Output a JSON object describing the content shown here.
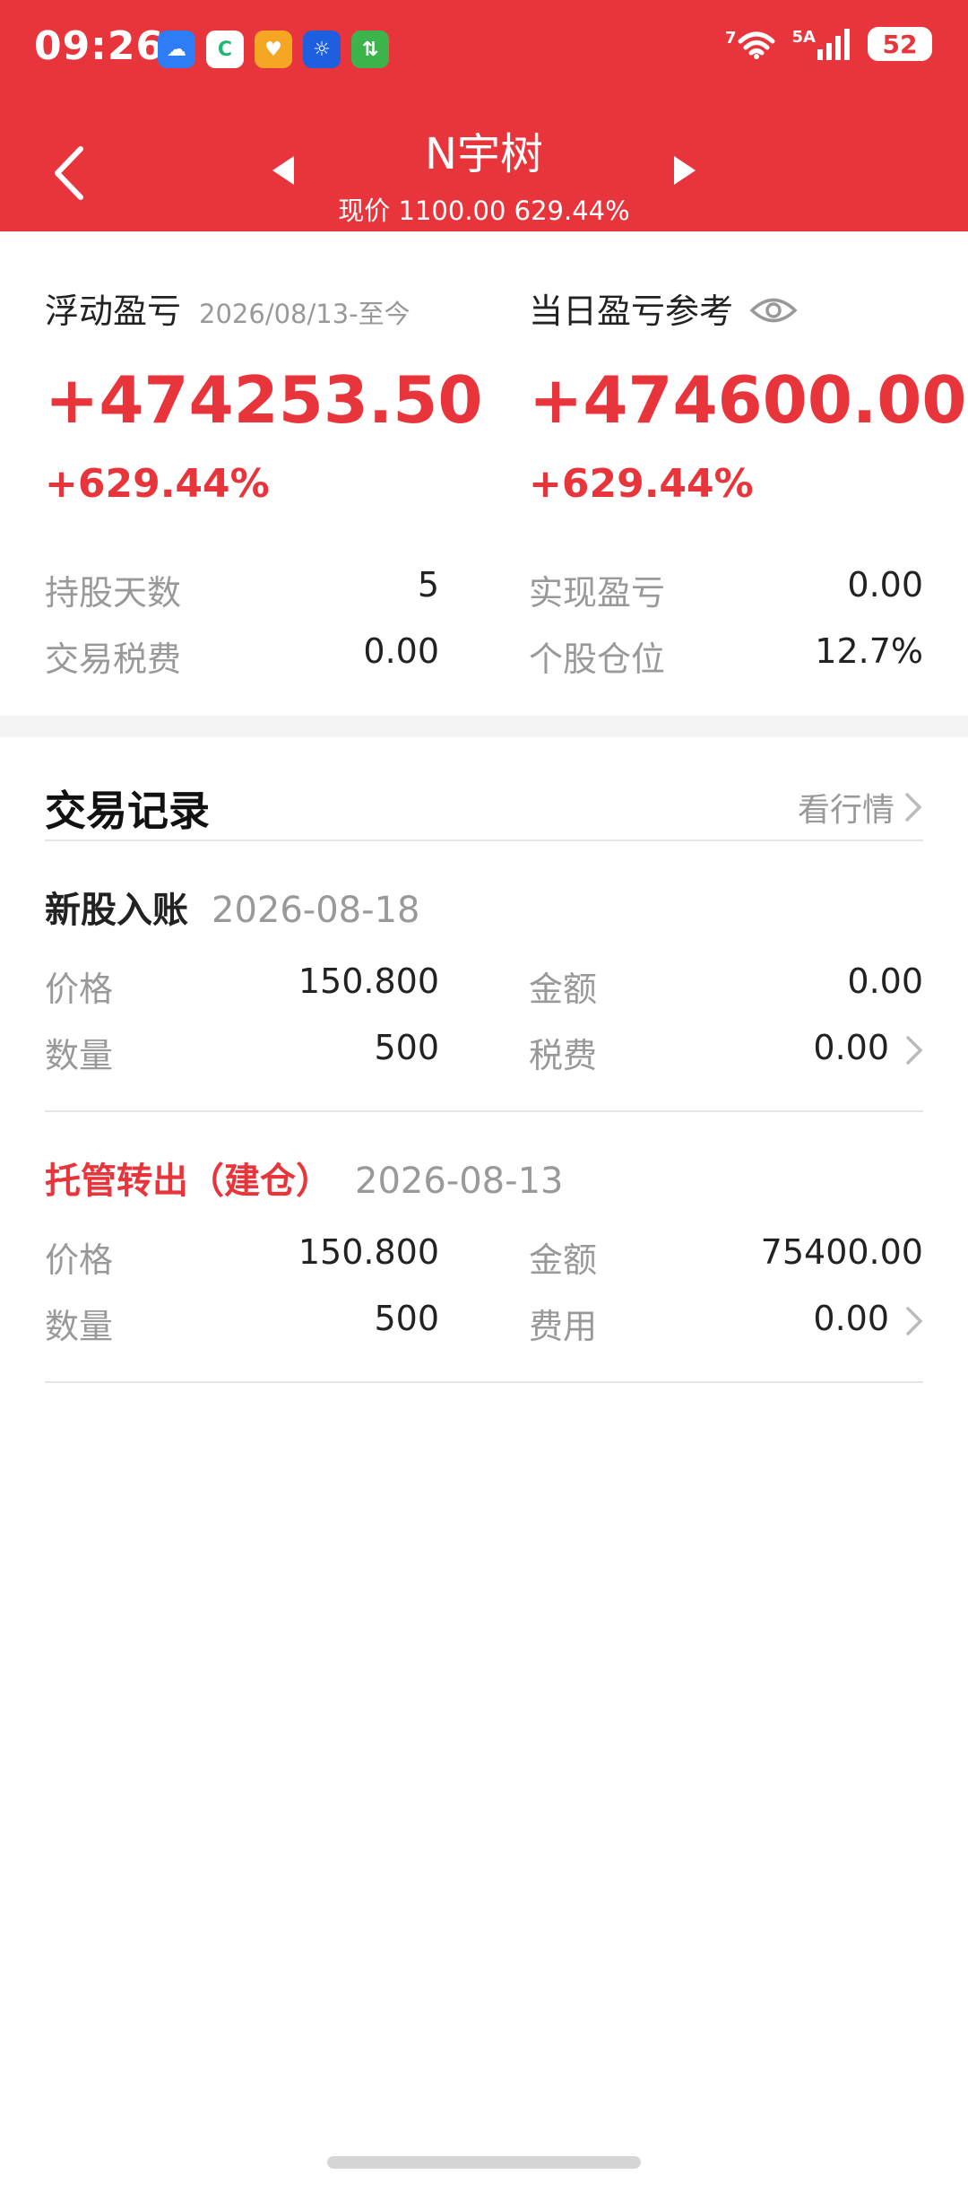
{
  "status_bar": {
    "time": "09:26",
    "apps": [
      {
        "name": "weather-icon",
        "glyph": "☁",
        "color": "#2f7df6"
      },
      {
        "name": "refresh-app-icon",
        "glyph": "C",
        "color": "#22b573"
      },
      {
        "name": "xiaomei-app-icon",
        "glyph": "♥",
        "color": "#f5a623"
      },
      {
        "name": "bulb-app-icon",
        "glyph": "☼",
        "color": "#1e5fe0"
      },
      {
        "name": "transfer-app-icon",
        "glyph": "⇅",
        "color": "#3cb44b"
      }
    ],
    "wifi_label": "7",
    "network_label": "5A",
    "battery": "52"
  },
  "header": {
    "title": "N宇树",
    "subtitle": "现价 1100.00 629.44%"
  },
  "summary": {
    "floating": {
      "label": "浮动盈亏",
      "date_range": "2026/08/13-至今",
      "value": "+474253.50",
      "pct": "+629.44%"
    },
    "daily": {
      "label": "当日盈亏参考",
      "value": "+474600.00",
      "pct": "+629.44%"
    },
    "stats": {
      "hold_days_label": "持股天数",
      "hold_days": "5",
      "realized_label": "实现盈亏",
      "realized": "0.00",
      "tax_label": "交易税费",
      "tax": "0.00",
      "position_label": "个股仓位",
      "position": "12.7%"
    }
  },
  "records": {
    "title": "交易记录",
    "market_link": "看行情",
    "items": [
      {
        "type": "新股入账",
        "date": "2026-08-18",
        "accent": "#222222",
        "price_label": "价格",
        "price": "150.800",
        "amount_label": "金额",
        "amount": "0.00",
        "qty_label": "数量",
        "qty": "500",
        "fee_label": "税费",
        "fee": "0.00"
      },
      {
        "type": "托管转出（建仓）",
        "date": "2026-08-13",
        "accent": "#e8353b",
        "price_label": "价格",
        "price": "150.800",
        "amount_label": "金额",
        "amount": "75400.00",
        "qty_label": "数量",
        "qty": "500",
        "fee_label": "费用",
        "fee": "0.00"
      }
    ]
  },
  "colors": {
    "brand_red": "#e8353b",
    "muted_text": "#999999",
    "main_text": "#222222"
  }
}
